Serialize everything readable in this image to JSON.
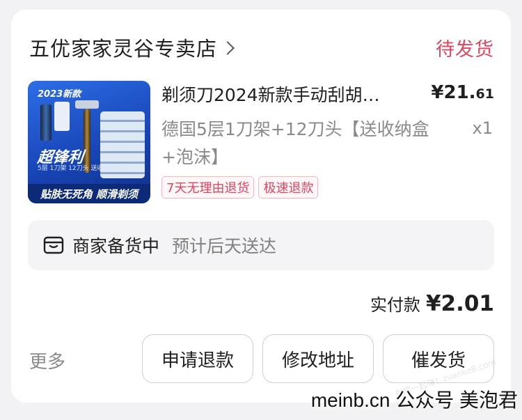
{
  "shop": {
    "name": "五优家家灵谷专卖店",
    "status": "待发货"
  },
  "product": {
    "title": "剃须刀2024新款手动刮胡…",
    "price_main": "¥21.",
    "price_cents": "61",
    "spec": "德国5层1刀架+12刀头【送收纳盒+泡沫】",
    "qty": "x1",
    "tags": [
      "7天无理由退货",
      "极速退款"
    ],
    "image_text": {
      "year": "2023新款",
      "brand": "超锋利",
      "sub": "5层 1刀架 12刀头 送收纳盒·泡沫",
      "slogan": "贴肤无死角 顺滑剃须"
    }
  },
  "notice": {
    "strong": "商家备货中",
    "light": "预计后天送达"
  },
  "payment": {
    "label": "实付款",
    "amount": "¥2.01"
  },
  "actions": {
    "more": "更多",
    "buttons": [
      "申请退款",
      "修改地址",
      "催发货"
    ]
  },
  "watermark": {
    "text": "meinb.cn 公众号 美泡君",
    "stamp": "有奖一起赚！zuanke8.com"
  },
  "colors": {
    "accent": "#e0455f",
    "text": "#1f1f1f",
    "muted": "#8a8a8a"
  }
}
